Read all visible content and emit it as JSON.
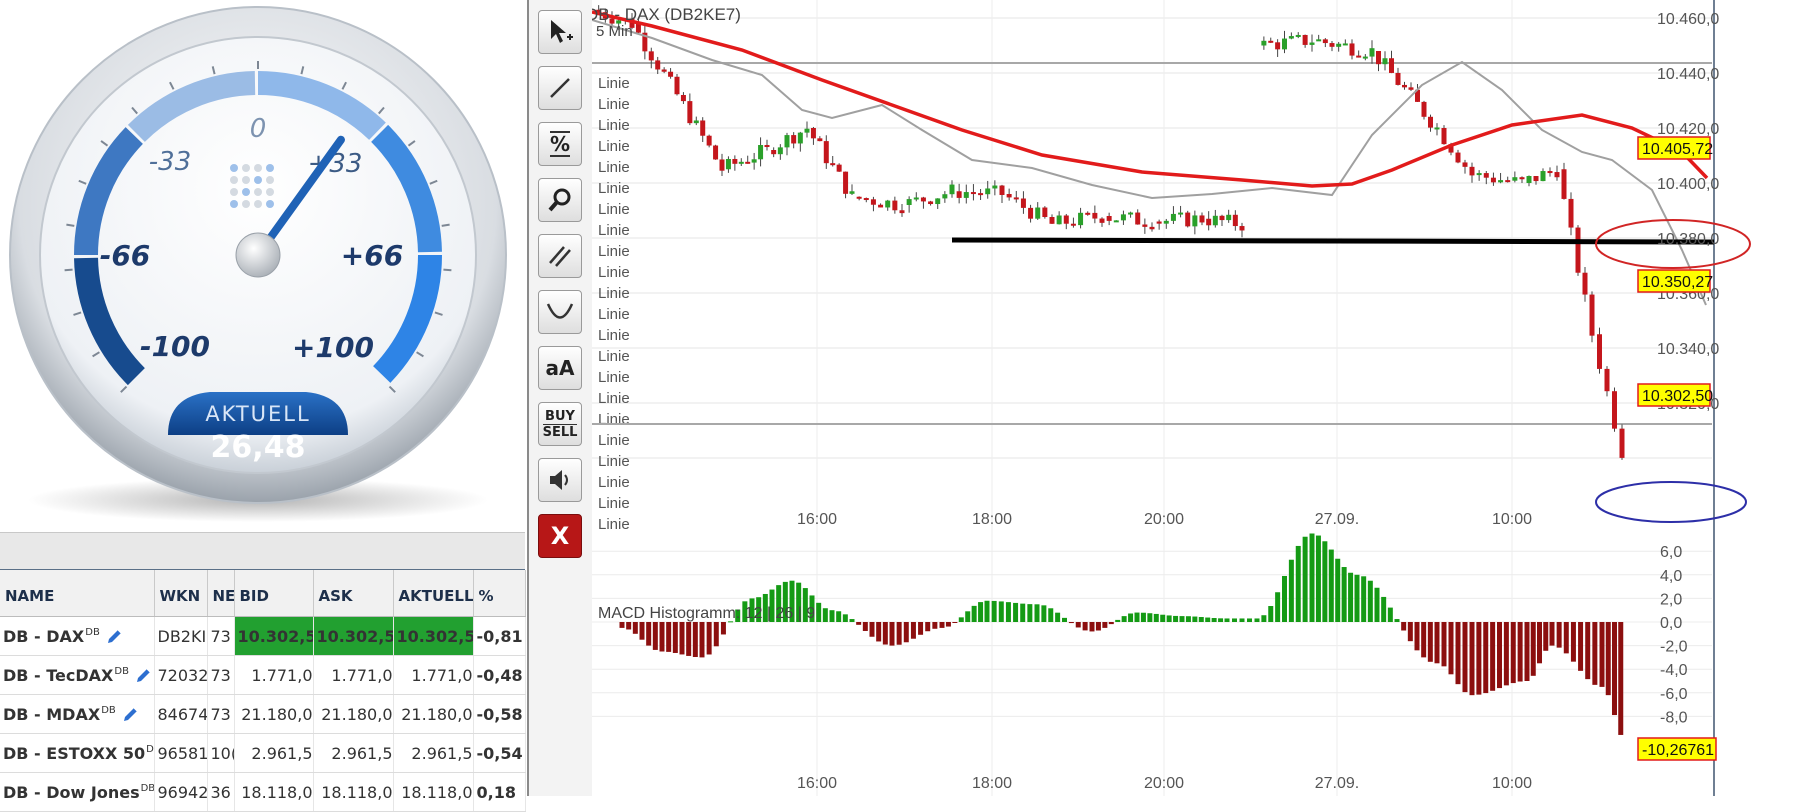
{
  "gauge": {
    "scale_labels": [
      "-100",
      "-66",
      "-33",
      "0",
      "+33",
      "+66",
      "+100"
    ],
    "current_label": "AKTUELL",
    "current_value": "26,48",
    "needle_value": 26.48
  },
  "watchlist": {
    "columns": [
      "NAME",
      "WKN",
      "NE",
      "BID",
      "ASK",
      "AKTUELL",
      "%"
    ],
    "rows": [
      {
        "name": "DB - DAX",
        "sup": "DB",
        "wkn": "DB2KI",
        "ne": "73",
        "bid": "10.302,5",
        "ask": "10.302,5",
        "aktuell": "10.302,5",
        "pct": "-0,81",
        "highlight": true,
        "positive": false,
        "pencil": true
      },
      {
        "name": "DB - TecDAX",
        "sup": "DB",
        "wkn": "72032",
        "ne": "73",
        "bid": "1.771,0",
        "ask": "1.771,0",
        "aktuell": "1.771,0",
        "pct": "-0,48",
        "highlight": false,
        "positive": false,
        "pencil": true
      },
      {
        "name": "DB - MDAX",
        "sup": "DB",
        "wkn": "84674",
        "ne": "73",
        "bid": "21.180,0",
        "ask": "21.180,0",
        "aktuell": "21.180,0",
        "pct": "-0,58",
        "highlight": false,
        "positive": false,
        "pencil": true
      },
      {
        "name": "DB - ESTOXX 50",
        "sup": "DB",
        "wkn": "96581",
        "ne": "10(",
        "bid": "2.961,5",
        "ask": "2.961,5",
        "aktuell": "2.961,5",
        "pct": "-0,54",
        "highlight": false,
        "positive": false,
        "pencil": false
      },
      {
        "name": "DB - Dow Jones",
        "sup": "DB",
        "wkn": "96942",
        "ne": "36",
        "bid": "18.118,0",
        "ask": "18.118,0",
        "aktuell": "18.118,0",
        "pct": "0,18",
        "highlight": false,
        "positive": true,
        "pencil": false
      }
    ]
  },
  "toolbar": {
    "tools": [
      {
        "icon": "cursor-plus-icon",
        "label": ""
      },
      {
        "icon": "line-draw-icon",
        "label": ""
      },
      {
        "icon": "percent-icon",
        "label": "%"
      },
      {
        "icon": "zoom-icon",
        "label": ""
      },
      {
        "icon": "parallel-lines-icon",
        "label": ""
      },
      {
        "icon": "arc-icon",
        "label": ""
      },
      {
        "icon": "text-icon",
        "label": "aA"
      },
      {
        "icon": "buy-sell-icon",
        "label": "BUY SELL"
      },
      {
        "icon": "speaker-icon",
        "label": ""
      },
      {
        "icon": "close-icon",
        "label": "X"
      }
    ]
  },
  "chart": {
    "title": "DB - DAX (DB2KE7)",
    "interval": "5 Min",
    "line_labels": [
      "Linie",
      "Linie",
      "Linie",
      "Linie",
      "Linie",
      "Linie",
      "Linie",
      "Linie",
      "Linie",
      "Linie",
      "Linie",
      "Linie",
      "Linie",
      "Linie",
      "Linie",
      "Linie",
      "Linie",
      "Linie",
      "Linie",
      "Linie",
      "Linie",
      "Linie"
    ],
    "x_tick_labels": [
      "16:00",
      "18:00",
      "20:00",
      "27.09.",
      "10:00"
    ],
    "y_tick_labels": [
      "10.460,0",
      "10.440,0",
      "10.420,0",
      "10.400,0",
      "10.380,0",
      "10.360,0",
      "10.340,0",
      "10.320,0"
    ],
    "price_tags": [
      "10.405,72",
      "10.350,27",
      "10.302,50"
    ],
    "macd_label": "MACD Histogramm: 12 | 26 | 9",
    "macd_tick_labels": [
      "6,0",
      "4,0",
      "2,0",
      "0,0",
      "-2,0",
      "-4,0",
      "-6,0",
      "-8,0"
    ],
    "macd_tag": "-10,26761",
    "colors": {
      "up": "#2aa02a",
      "down": "#c4161c",
      "ma_slow": "#e21b1b",
      "ma_fast": "#a0a0a0",
      "hist_pos": "#149a14",
      "hist_neg": "#8c0f0f",
      "tag_bg": "#ffff00"
    }
  },
  "chart_data": [
    {
      "type": "line",
      "title": "DB - DAX (DB2KE7)",
      "x": [
        "14:55",
        "15:30",
        "16:00",
        "16:30",
        "17:00",
        "17:30",
        "18:00",
        "18:30",
        "19:00",
        "19:30",
        "20:00",
        "20:30",
        "21:00",
        "21:30",
        "22:00",
        "27.09. 08:00",
        "08:30",
        "09:00",
        "09:30",
        "10:00",
        "10:30",
        "11:00",
        "11:15",
        "11:25"
      ],
      "series": [
        {
          "values": [
            10463,
            10458,
            10432,
            10405,
            10412,
            10420,
            10395,
            10392,
            10397,
            10396,
            10385,
            10388,
            10386,
            10387,
            10385,
            10450,
            10452,
            10448,
            10420,
            10403,
            10400,
            10405,
            10345,
            10302.5
          ]
        }
      ],
      "ylim": [
        10290,
        10470
      ],
      "annotations": [
        "10.405,72",
        "10.350,27",
        "10.302,50"
      ]
    },
    {
      "type": "bar",
      "title": "MACD Histogramm: 12 | 26 | 9",
      "categories": [
        "15:00",
        "15:30",
        "16:00",
        "16:30",
        "17:00",
        "17:30",
        "18:00",
        "18:30",
        "19:00",
        "19:30",
        "20:00",
        "20:30",
        "21:00",
        "21:30",
        "22:00",
        "27.09. 08:00",
        "08:30",
        "09:00",
        "09:30",
        "10:00",
        "10:30",
        "11:00",
        "11:25"
      ],
      "values": [
        -0.5,
        -2.5,
        -3.0,
        2.0,
        3.5,
        1.0,
        -2.0,
        -0.5,
        1.8,
        1.5,
        -0.8,
        0.8,
        0.5,
        0.3,
        0.3,
        7.5,
        4.0,
        -3.5,
        -6.2,
        -5.0,
        -2.0,
        -5.5,
        -10.27
      ],
      "ylim": [
        -10.5,
        6.5
      ],
      "annotations": [
        "-10,26761"
      ]
    }
  ]
}
